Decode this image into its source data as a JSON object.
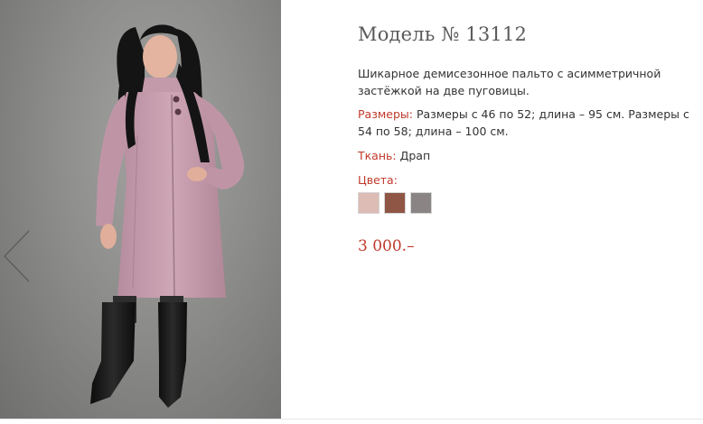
{
  "product": {
    "title": "Модель № 13112",
    "description": "Шикарное демисезонное пальто с асимметричной застёжкой на две пуговицы.",
    "sizes_label": "Размеры:",
    "sizes_value": "Размеры с 46 по 52; длина – 95 см. Размеры с 54 по 58; длина – 100 см.",
    "fabric_label": "Ткань:",
    "fabric_value": "Драп",
    "colors_label": "Цвета:",
    "colors": [
      "#dcbcb4",
      "#8f5646",
      "#8a8584"
    ],
    "price": "3 000.–"
  },
  "icons": {
    "prev": "chevron-left-icon"
  }
}
